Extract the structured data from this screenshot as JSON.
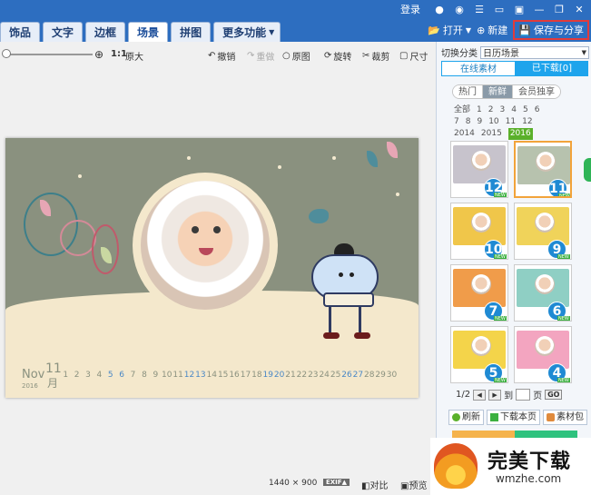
{
  "topbar": {
    "login": "登录"
  },
  "tabs": [
    {
      "label": "饰品"
    },
    {
      "label": "文字"
    },
    {
      "label": "边框"
    },
    {
      "label": "场景",
      "active": true
    },
    {
      "label": "拼图"
    },
    {
      "label": "更多功能"
    }
  ],
  "tabbar_right": {
    "open": "打开",
    "new": "新建",
    "save_share": "保存与分享"
  },
  "toolbar": {
    "one_to_one": "1:1",
    "original_size": "原大",
    "undo": "撤销",
    "redo": "重做",
    "original": "原图",
    "rotate": "旋转",
    "crop": "裁剪",
    "size": "尺寸"
  },
  "calendar": {
    "month_en": "Nov",
    "year": "2016",
    "month_num": "11",
    "month_cn": "月",
    "days": [
      "1",
      "2",
      "3",
      "4",
      "5",
      "6",
      "7",
      "8",
      "9",
      "10",
      "11",
      "12",
      "13",
      "14",
      "15",
      "16",
      "17",
      "18",
      "19",
      "20",
      "21",
      "22",
      "23",
      "24",
      "25",
      "26",
      "27",
      "28",
      "29",
      "30"
    ]
  },
  "status": {
    "resolution": "1440 × 900",
    "exif": "EXIF▲",
    "compare": "对比",
    "preview": "预览"
  },
  "panel": {
    "category_label": "切换分类",
    "category_value": "日历场景",
    "seg_online": "在线素材",
    "seg_downloaded": "已下载[0]",
    "subtabs": [
      "热门",
      "新鲜",
      "会员独享"
    ],
    "filters": [
      "全部",
      "1",
      "2",
      "3",
      "4",
      "5",
      "6",
      "7",
      "8",
      "9",
      "10",
      "11",
      "12",
      "2014",
      "2015",
      "2016"
    ],
    "thumbs": [
      {
        "num": "12",
        "tag": "NEW",
        "bg": "#c7c3cc"
      },
      {
        "num": "11",
        "tag": "NEW",
        "bg": "#b7c2ae"
      },
      {
        "num": "10",
        "tag": "NEW",
        "bg": "#f0c64a"
      },
      {
        "num": "9",
        "tag": "NEW",
        "bg": "#f0d35a"
      },
      {
        "num": "7",
        "tag": "NEW",
        "bg": "#f09c4a"
      },
      {
        "num": "6",
        "tag": "NEW",
        "bg": "#8fcfc4"
      },
      {
        "num": "5",
        "tag": "NEW",
        "bg": "#f4d44a"
      },
      {
        "num": "4",
        "tag": "NEW",
        "bg": "#f3a5c0"
      }
    ],
    "pager": {
      "current": "1/2",
      "goto": "到",
      "page": "页",
      "go": "GO"
    },
    "refresh": "刷新",
    "download_page": "下载本页",
    "material_pack": "素材包"
  },
  "watermark": {
    "title": "完美下载",
    "url": "wmzhe.com"
  },
  "colors": {
    "accent": "#2d6ec0",
    "seg_blue": "#1ea4ec",
    "save_border": "#e13b3b",
    "badge_blue": "#1f8ad3",
    "new_green": "#3cb040"
  }
}
